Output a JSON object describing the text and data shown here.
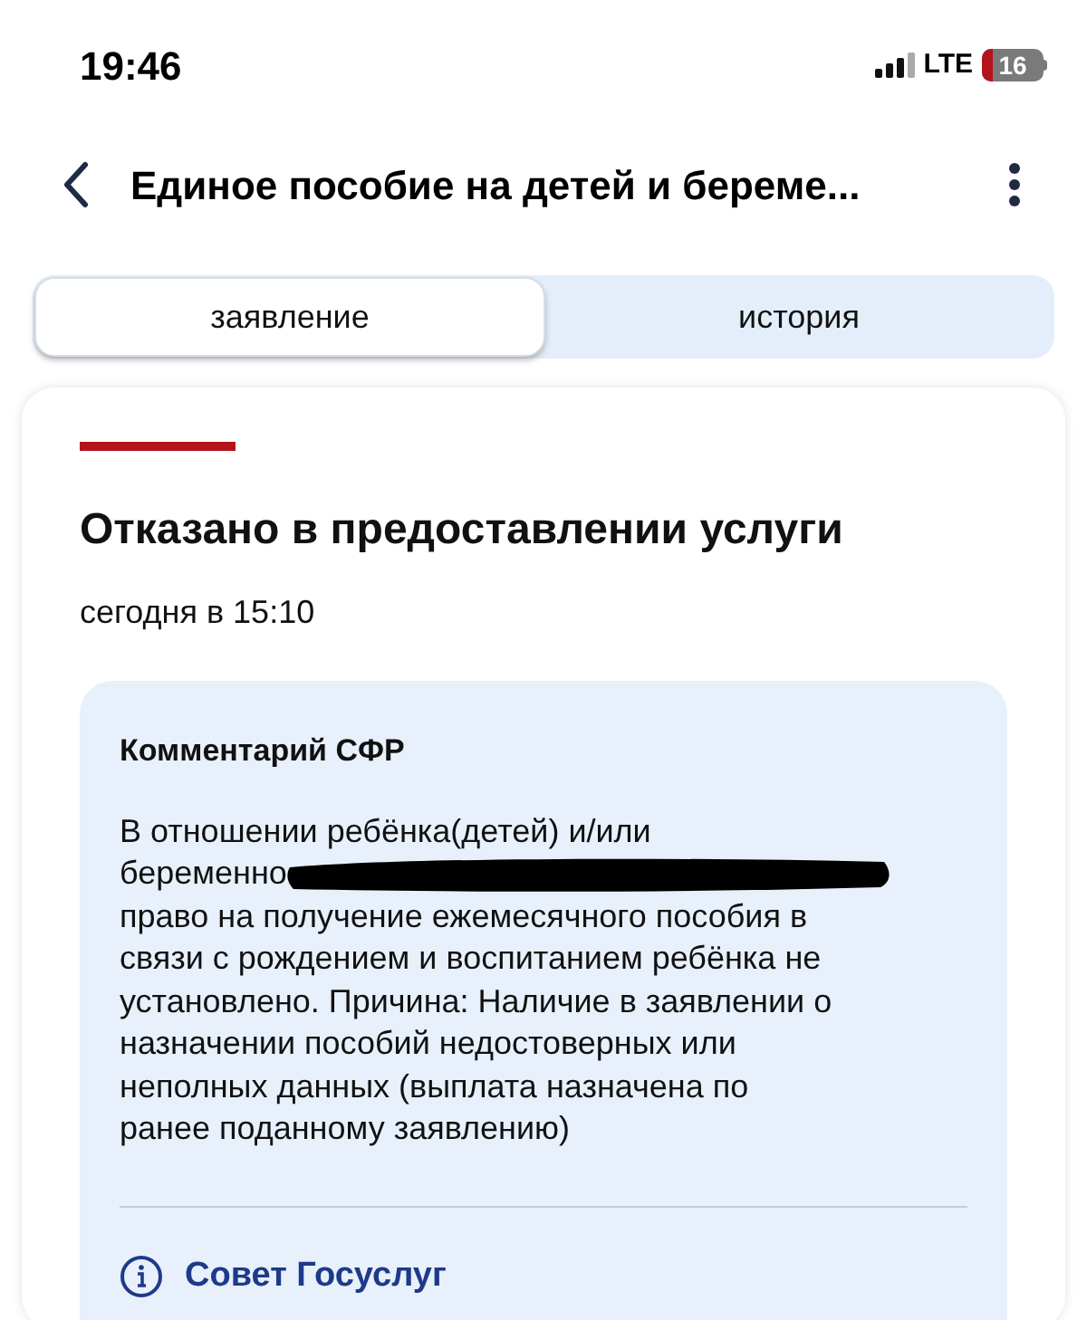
{
  "status_bar": {
    "time": "19:46",
    "network": "LTE",
    "battery": "16"
  },
  "header": {
    "title": "Единое пособие на детей и береме..."
  },
  "tabs": [
    {
      "label": "заявление",
      "selected": true
    },
    {
      "label": "история",
      "selected": false
    }
  ],
  "status_card": {
    "title": "Отказано в предоставлении услуги",
    "subtitle": "сегодня в 15:10",
    "comment": {
      "heading": "Комментарий СФР",
      "text_before": "В отношении ребёнка(детей) и/или",
      "cut_word": "беременно",
      "text_after": "право на получение ежемесячного пособия в\nсвязи с рождением и воспитанием ребёнка не\nустановлено. Причина: Наличие в заявлении о\nназначении пособий недостоверных или\nнеполных данных (выплата назначена по\nранее поданному заявлению)",
      "redacted": true,
      "link": "Совет Госуслуг"
    }
  }
}
